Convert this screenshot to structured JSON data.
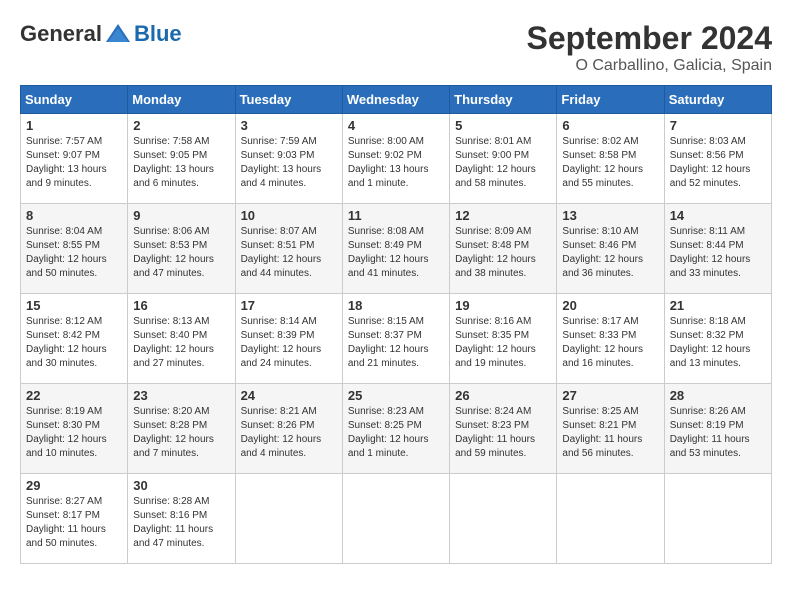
{
  "header": {
    "logo_general": "General",
    "logo_blue": "Blue",
    "month_year": "September 2024",
    "location": "O Carballino, Galicia, Spain"
  },
  "days_of_week": [
    "Sunday",
    "Monday",
    "Tuesday",
    "Wednesday",
    "Thursday",
    "Friday",
    "Saturday"
  ],
  "weeks": [
    [
      {
        "day": "1",
        "sunrise": "Sunrise: 7:57 AM",
        "sunset": "Sunset: 9:07 PM",
        "daylight": "Daylight: 13 hours and 9 minutes."
      },
      {
        "day": "2",
        "sunrise": "Sunrise: 7:58 AM",
        "sunset": "Sunset: 9:05 PM",
        "daylight": "Daylight: 13 hours and 6 minutes."
      },
      {
        "day": "3",
        "sunrise": "Sunrise: 7:59 AM",
        "sunset": "Sunset: 9:03 PM",
        "daylight": "Daylight: 13 hours and 4 minutes."
      },
      {
        "day": "4",
        "sunrise": "Sunrise: 8:00 AM",
        "sunset": "Sunset: 9:02 PM",
        "daylight": "Daylight: 13 hours and 1 minute."
      },
      {
        "day": "5",
        "sunrise": "Sunrise: 8:01 AM",
        "sunset": "Sunset: 9:00 PM",
        "daylight": "Daylight: 12 hours and 58 minutes."
      },
      {
        "day": "6",
        "sunrise": "Sunrise: 8:02 AM",
        "sunset": "Sunset: 8:58 PM",
        "daylight": "Daylight: 12 hours and 55 minutes."
      },
      {
        "day": "7",
        "sunrise": "Sunrise: 8:03 AM",
        "sunset": "Sunset: 8:56 PM",
        "daylight": "Daylight: 12 hours and 52 minutes."
      }
    ],
    [
      {
        "day": "8",
        "sunrise": "Sunrise: 8:04 AM",
        "sunset": "Sunset: 8:55 PM",
        "daylight": "Daylight: 12 hours and 50 minutes."
      },
      {
        "day": "9",
        "sunrise": "Sunrise: 8:06 AM",
        "sunset": "Sunset: 8:53 PM",
        "daylight": "Daylight: 12 hours and 47 minutes."
      },
      {
        "day": "10",
        "sunrise": "Sunrise: 8:07 AM",
        "sunset": "Sunset: 8:51 PM",
        "daylight": "Daylight: 12 hours and 44 minutes."
      },
      {
        "day": "11",
        "sunrise": "Sunrise: 8:08 AM",
        "sunset": "Sunset: 8:49 PM",
        "daylight": "Daylight: 12 hours and 41 minutes."
      },
      {
        "day": "12",
        "sunrise": "Sunrise: 8:09 AM",
        "sunset": "Sunset: 8:48 PM",
        "daylight": "Daylight: 12 hours and 38 minutes."
      },
      {
        "day": "13",
        "sunrise": "Sunrise: 8:10 AM",
        "sunset": "Sunset: 8:46 PM",
        "daylight": "Daylight: 12 hours and 36 minutes."
      },
      {
        "day": "14",
        "sunrise": "Sunrise: 8:11 AM",
        "sunset": "Sunset: 8:44 PM",
        "daylight": "Daylight: 12 hours and 33 minutes."
      }
    ],
    [
      {
        "day": "15",
        "sunrise": "Sunrise: 8:12 AM",
        "sunset": "Sunset: 8:42 PM",
        "daylight": "Daylight: 12 hours and 30 minutes."
      },
      {
        "day": "16",
        "sunrise": "Sunrise: 8:13 AM",
        "sunset": "Sunset: 8:40 PM",
        "daylight": "Daylight: 12 hours and 27 minutes."
      },
      {
        "day": "17",
        "sunrise": "Sunrise: 8:14 AM",
        "sunset": "Sunset: 8:39 PM",
        "daylight": "Daylight: 12 hours and 24 minutes."
      },
      {
        "day": "18",
        "sunrise": "Sunrise: 8:15 AM",
        "sunset": "Sunset: 8:37 PM",
        "daylight": "Daylight: 12 hours and 21 minutes."
      },
      {
        "day": "19",
        "sunrise": "Sunrise: 8:16 AM",
        "sunset": "Sunset: 8:35 PM",
        "daylight": "Daylight: 12 hours and 19 minutes."
      },
      {
        "day": "20",
        "sunrise": "Sunrise: 8:17 AM",
        "sunset": "Sunset: 8:33 PM",
        "daylight": "Daylight: 12 hours and 16 minutes."
      },
      {
        "day": "21",
        "sunrise": "Sunrise: 8:18 AM",
        "sunset": "Sunset: 8:32 PM",
        "daylight": "Daylight: 12 hours and 13 minutes."
      }
    ],
    [
      {
        "day": "22",
        "sunrise": "Sunrise: 8:19 AM",
        "sunset": "Sunset: 8:30 PM",
        "daylight": "Daylight: 12 hours and 10 minutes."
      },
      {
        "day": "23",
        "sunrise": "Sunrise: 8:20 AM",
        "sunset": "Sunset: 8:28 PM",
        "daylight": "Daylight: 12 hours and 7 minutes."
      },
      {
        "day": "24",
        "sunrise": "Sunrise: 8:21 AM",
        "sunset": "Sunset: 8:26 PM",
        "daylight": "Daylight: 12 hours and 4 minutes."
      },
      {
        "day": "25",
        "sunrise": "Sunrise: 8:23 AM",
        "sunset": "Sunset: 8:25 PM",
        "daylight": "Daylight: 12 hours and 1 minute."
      },
      {
        "day": "26",
        "sunrise": "Sunrise: 8:24 AM",
        "sunset": "Sunset: 8:23 PM",
        "daylight": "Daylight: 11 hours and 59 minutes."
      },
      {
        "day": "27",
        "sunrise": "Sunrise: 8:25 AM",
        "sunset": "Sunset: 8:21 PM",
        "daylight": "Daylight: 11 hours and 56 minutes."
      },
      {
        "day": "28",
        "sunrise": "Sunrise: 8:26 AM",
        "sunset": "Sunset: 8:19 PM",
        "daylight": "Daylight: 11 hours and 53 minutes."
      }
    ],
    [
      {
        "day": "29",
        "sunrise": "Sunrise: 8:27 AM",
        "sunset": "Sunset: 8:17 PM",
        "daylight": "Daylight: 11 hours and 50 minutes."
      },
      {
        "day": "30",
        "sunrise": "Sunrise: 8:28 AM",
        "sunset": "Sunset: 8:16 PM",
        "daylight": "Daylight: 11 hours and 47 minutes."
      },
      null,
      null,
      null,
      null,
      null
    ]
  ]
}
